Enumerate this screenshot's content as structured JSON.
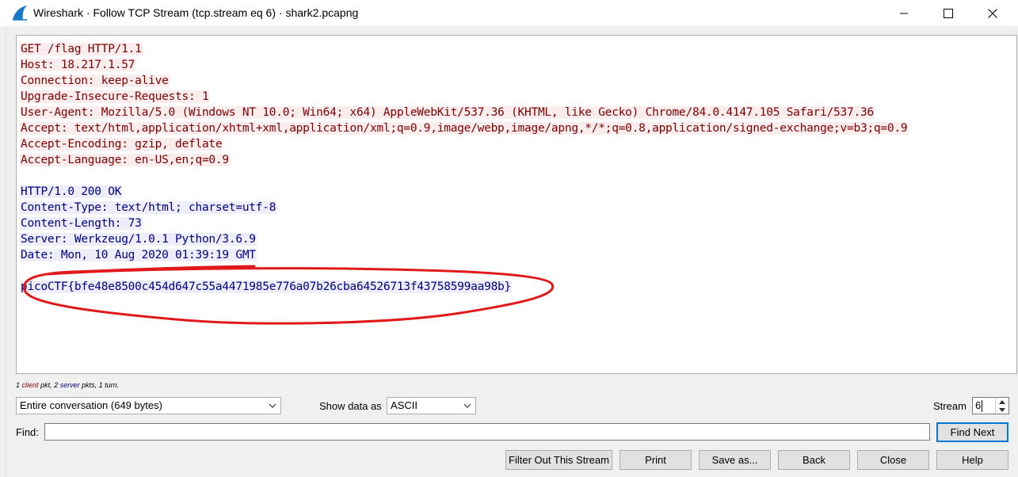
{
  "window": {
    "title": "Wireshark · Follow TCP Stream (tcp.stream eq 6) · shark2.pcapng",
    "controls": [
      "minimize",
      "maximize",
      "close"
    ]
  },
  "stream": {
    "request_lines": [
      "GET /flag HTTP/1.1",
      "Host: 18.217.1.57",
      "Connection: keep-alive",
      "Upgrade-Insecure-Requests: 1",
      "User-Agent: Mozilla/5.0 (Windows NT 10.0; Win64; x64) AppleWebKit/537.36 (KHTML, like Gecko) Chrome/84.0.4147.105 Safari/537.36",
      "Accept: text/html,application/xhtml+xml,application/xml;q=0.9,image/webp,image/apng,*/*;q=0.8,application/signed-exchange;v=b3;q=0.9",
      "Accept-Encoding: gzip, deflate",
      "Accept-Language: en-US,en;q=0.9"
    ],
    "response_lines": [
      "HTTP/1.0 200 OK",
      "Content-Type: text/html; charset=utf-8",
      "Content-Length: 73",
      "Server: Werkzeug/1.0.1 Python/3.6.9",
      "Date: Mon, 10 Aug 2020 01:39:19 GMT"
    ],
    "body_line": "picoCTF{bfe48e8500c454d647c55a4471985e776a07b26cba64526713f43758599aa98b}",
    "client_color": "#7f0000",
    "client_bg": "#fbeded",
    "server_color": "#000080",
    "server_bg": "#ededfb",
    "annotation_color": "#e0191b"
  },
  "summary": {
    "client_count": "1",
    "client_word": "client",
    "client_rest": "pkt,",
    "server_count": "2",
    "server_word": "server",
    "server_rest": "pkts, 1 turn."
  },
  "controls": {
    "conversation_select": "Entire conversation (649 bytes)",
    "show_data_label": "Show data as",
    "show_data_select": "ASCII",
    "stream_label": "Stream",
    "stream_value": "6",
    "find_label": "Find:",
    "find_value": "",
    "find_next": "Find Next"
  },
  "buttons": {
    "filter_out": "Filter Out This Stream",
    "print": "Print",
    "save_as": "Save as...",
    "back": "Back",
    "close": "Close",
    "help": "Help"
  },
  "icons": {
    "app": "wireshark-fin-icon",
    "minimize": "minimize-icon",
    "maximize": "maximize-icon",
    "close": "close-icon"
  }
}
